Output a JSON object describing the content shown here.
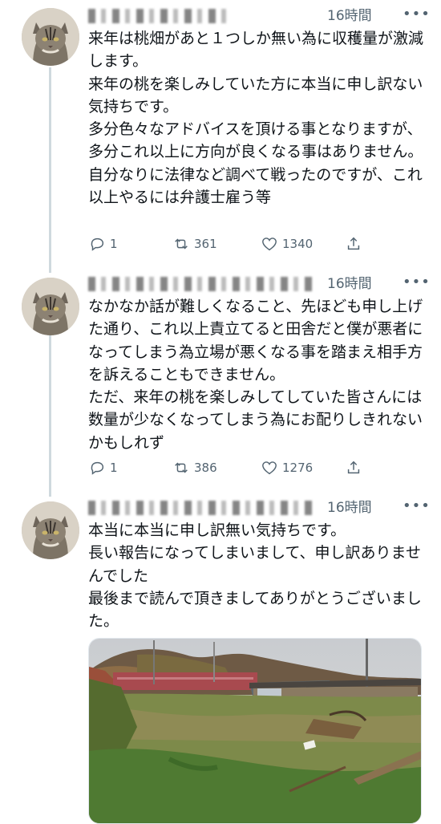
{
  "tweets": [
    {
      "time": "16時間",
      "more": "•••",
      "text": "来年は桃畑があと１つしか無い為に収穫量が激減します。\n来年の桃を楽しみしていた方に本当に申し訳ない気持ちです。\n多分色々なアドバイスを頂ける事となりますが、多分これ以上に方向が良くなる事はありません。\n自分なりに法律など調べて戦ったのですが、これ以上やるには弁護士雇う等",
      "replies": "1",
      "retweets": "361",
      "likes": "1340"
    },
    {
      "time": "16時間",
      "more": "•••",
      "text": "なかなか話が難しくなること、先ほども申し上げた通り、これ以上責立てると田舎だと僕が悪者になってしまう為立場が悪くなる事を踏まえ相手方を訴えることもできません。\nただ、来年の桃を楽しみしてしていた皆さんには数量が少なくなってしまう為にお配りしきれないかもしれず",
      "replies": "1",
      "retweets": "386",
      "likes": "1276"
    },
    {
      "time": "16時間",
      "more": "•••",
      "text": "本当に本当に申し訳無い気持ちです。\n長い報告になってしまいまして、申し訳ありませんでした\n最後まで読んで頂きましてありがとうございました。"
    }
  ],
  "icons": {
    "reply": "reply-icon",
    "retweet": "retweet-icon",
    "like": "heart-icon",
    "share": "share-icon"
  },
  "colors": {
    "secondary_text": "#536471",
    "thread_line": "#cfd9de"
  }
}
